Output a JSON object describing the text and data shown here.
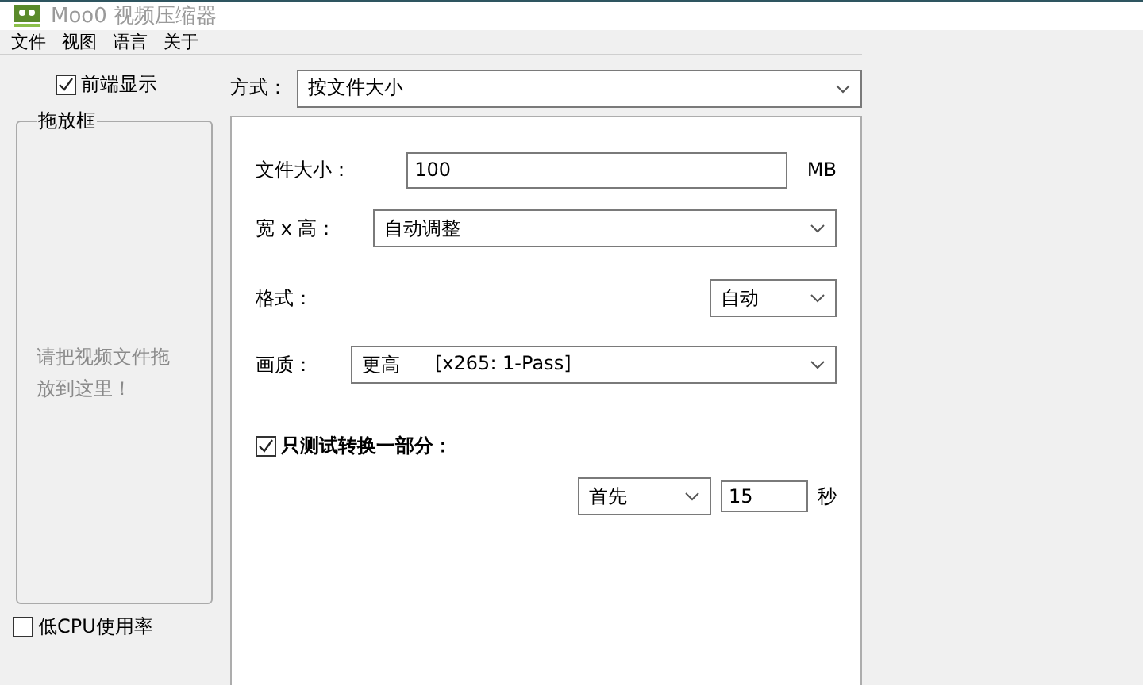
{
  "window": {
    "title": "Moo0 视频压缩器"
  },
  "menu": [
    "文件",
    "视图",
    "语言",
    "关于"
  ],
  "always_on_top": {
    "label": "前端显示",
    "checked": true
  },
  "drop_box": {
    "title": "拖放框",
    "hint": "请把视频文件拖放到这里！"
  },
  "low_cpu": {
    "label": "低CPU使用率",
    "checked": false
  },
  "mode": {
    "label": "方式：",
    "value": "按文件大小"
  },
  "file_size": {
    "label": "文件大小：",
    "value": "100",
    "unit": "MB"
  },
  "dimensions": {
    "label": "宽 x 高：",
    "value": "自动调整"
  },
  "format": {
    "label": "格式：",
    "value": "自动"
  },
  "quality": {
    "label": "画质：",
    "value": "更高",
    "codec": "[x265: 1-Pass]"
  },
  "test_part": {
    "label": "只测试转换一部分：",
    "checked": true,
    "position": "首先",
    "seconds": "15",
    "unit": "秒"
  }
}
